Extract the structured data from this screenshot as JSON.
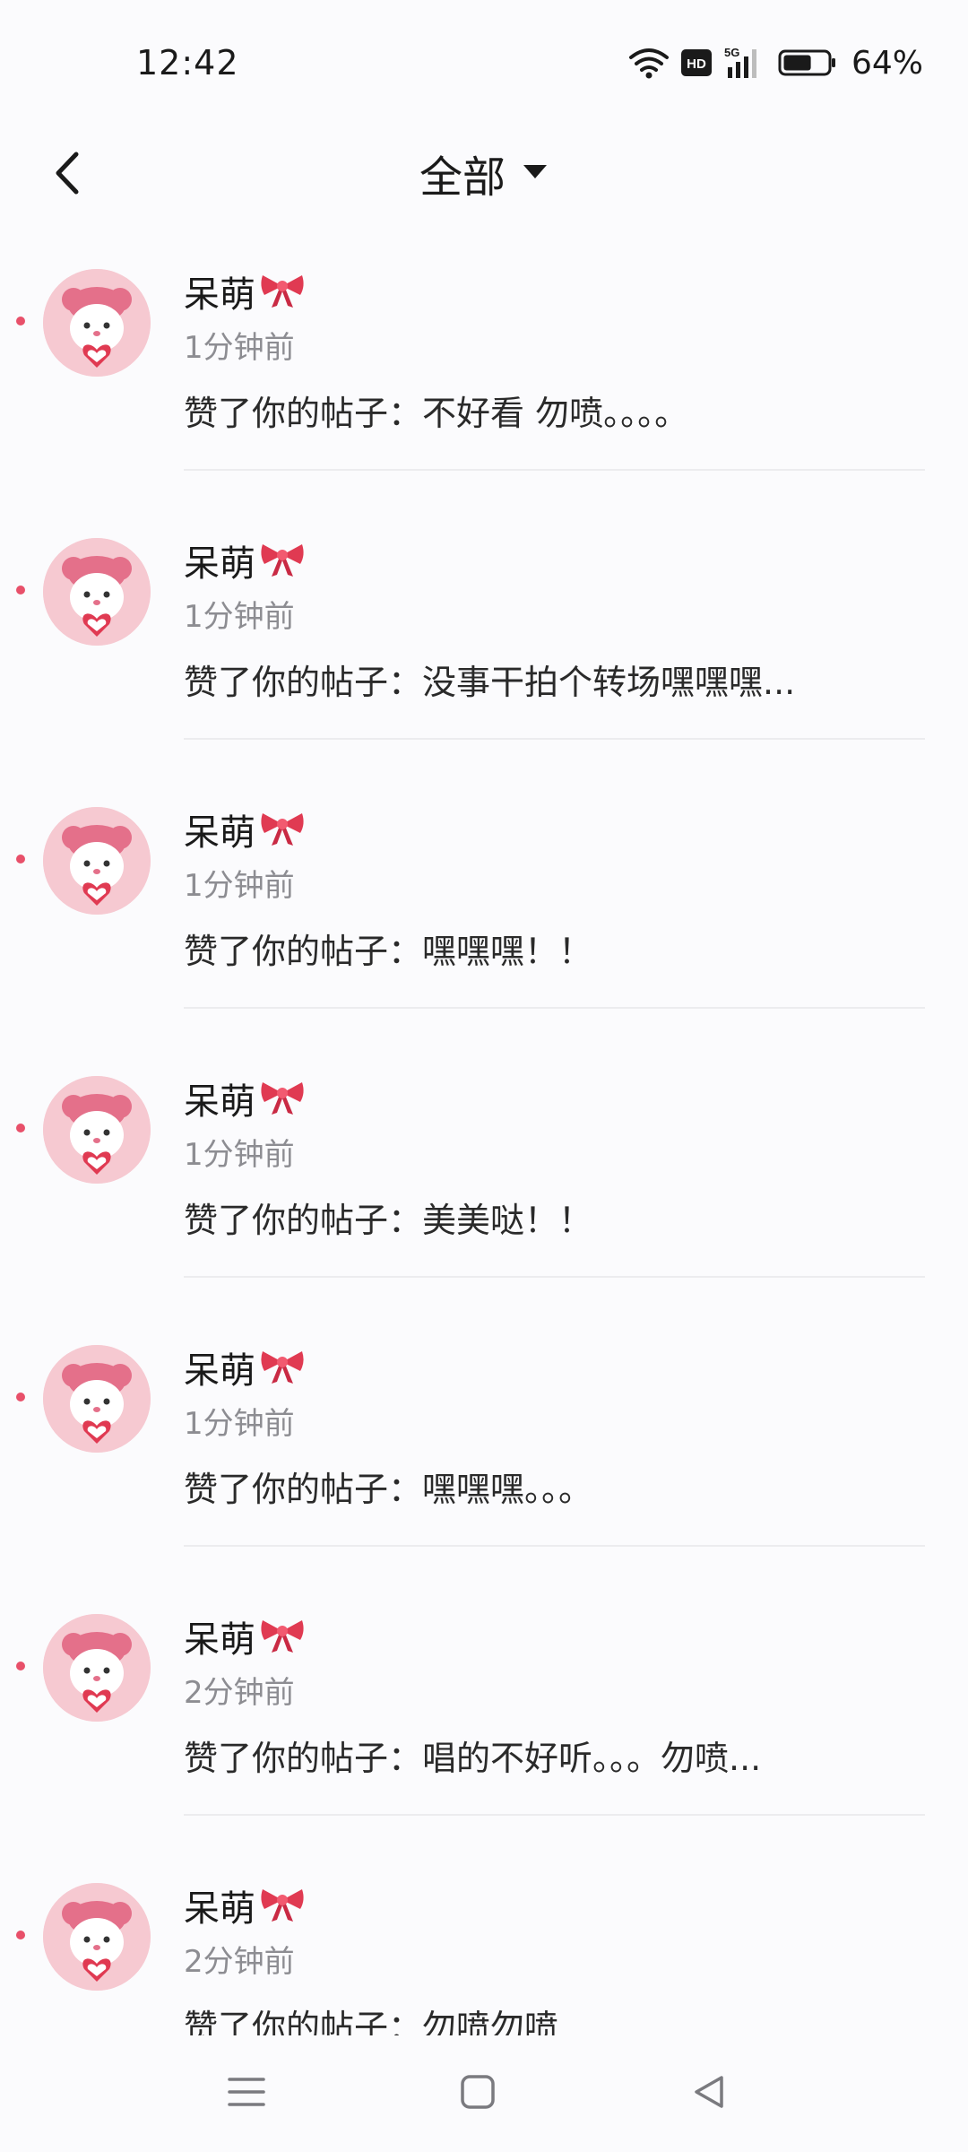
{
  "status_bar": {
    "time": "12:42",
    "network_badge": "HD",
    "cell_label": "5G",
    "battery_percent": "64%",
    "battery_level": 0.64
  },
  "header": {
    "title": "全部",
    "back_icon": "chevron-left-icon",
    "dropdown_icon": "caret-down-icon"
  },
  "notifications": [
    {
      "name": "呆萌",
      "time": "1分钟前",
      "message": "赞了你的帖子：不好看 勿喷。。。。"
    },
    {
      "name": "呆萌",
      "time": "1分钟前",
      "message": "赞了你的帖子：没事干拍个转场嘿嘿嘿..."
    },
    {
      "name": "呆萌",
      "time": "1分钟前",
      "message": "赞了你的帖子：嘿嘿嘿！！"
    },
    {
      "name": "呆萌",
      "time": "1分钟前",
      "message": "赞了你的帖子：美美哒！！"
    },
    {
      "name": "呆萌",
      "time": "1分钟前",
      "message": "赞了你的帖子：嘿嘿嘿。。。"
    },
    {
      "name": "呆萌",
      "time": "2分钟前",
      "message": "赞了你的帖子：唱的不好听。。。勿喷..."
    },
    {
      "name": "呆萌",
      "time": "2分钟前",
      "message": "赞了你的帖子：勿喷勿喷"
    }
  ],
  "colors": {
    "unread_dot": "#e8506a",
    "bow": "#e03a52",
    "avatar_bg": "#f6c9d1"
  },
  "nav_bar": {
    "icons": [
      "menu-icon",
      "home-square-icon",
      "back-triangle-icon"
    ]
  }
}
